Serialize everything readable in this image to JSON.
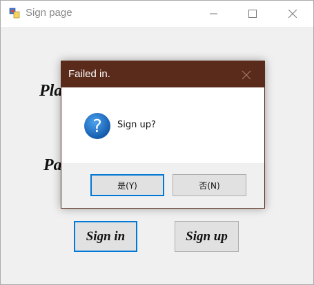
{
  "window": {
    "title": "Sign page",
    "app_icon": "winforms-app-icon",
    "controls": {
      "minimize": "minimize-icon",
      "maximize": "maximize-icon",
      "close": "close-icon"
    }
  },
  "form": {
    "player_label": "Pla",
    "password_label": "Pa",
    "sign_in_label": "Sign in",
    "sign_up_label": "Sign up"
  },
  "dialog": {
    "title": "Failed in.",
    "message": "Sign up?",
    "icon": "question-icon",
    "yes_label": "是(Y)",
    "no_label": "否(N)"
  },
  "colors": {
    "dialog_titlebar": "#5a2a1a",
    "focus_border": "#0078d7",
    "question_icon": "#1c6fbf"
  }
}
